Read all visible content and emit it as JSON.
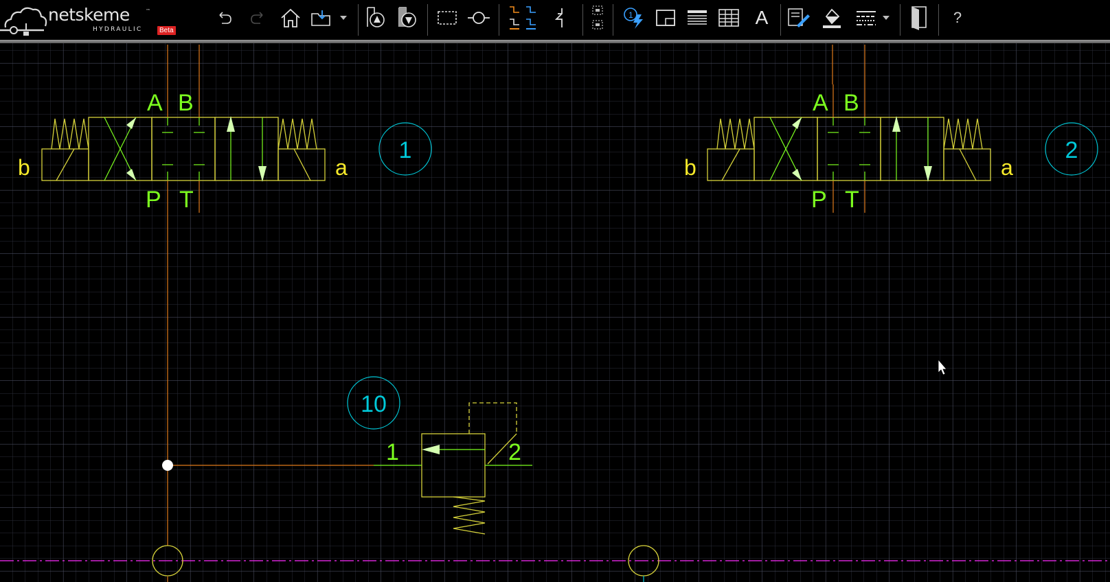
{
  "app": {
    "name": "netskeme",
    "trademark": "™",
    "subtitle": "HYDRAULIC",
    "badge": "Beta"
  },
  "toolbar": {
    "items": [
      {
        "id": "undo",
        "icon": "undo-icon"
      },
      {
        "id": "redo",
        "icon": "redo-icon"
      },
      {
        "id": "home",
        "icon": "home-icon"
      },
      {
        "id": "open",
        "icon": "open-folder-icon"
      },
      {
        "id": "open-menu",
        "icon": "dropdown-arrow-icon"
      },
      {
        "id": "add-pump",
        "icon": "add-pump-icon"
      },
      {
        "id": "add-motor",
        "icon": "add-motor-icon"
      },
      {
        "id": "select-area",
        "icon": "select-rectangle-icon"
      },
      {
        "id": "connection-point",
        "icon": "connection-point-icon"
      },
      {
        "id": "line-styles",
        "icon": "line-styles-icon"
      },
      {
        "id": "jump-line",
        "icon": "jump-line-icon"
      },
      {
        "id": "group",
        "icon": "group-icon"
      },
      {
        "id": "numbering",
        "icon": "numbering-icon"
      },
      {
        "id": "frame",
        "icon": "frame-icon"
      },
      {
        "id": "parts-list",
        "icon": "parts-list-icon"
      },
      {
        "id": "table",
        "icon": "table-icon"
      },
      {
        "id": "text",
        "icon": "text-icon",
        "label": "A"
      },
      {
        "id": "edit-properties",
        "icon": "edit-properties-icon"
      },
      {
        "id": "fill-color",
        "icon": "fill-color-icon"
      },
      {
        "id": "line-type",
        "icon": "line-type-icon"
      },
      {
        "id": "line-type-menu",
        "icon": "dropdown-arrow-icon"
      },
      {
        "id": "exit",
        "icon": "exit-door-icon"
      },
      {
        "id": "help",
        "icon": "help-icon",
        "label": "?"
      }
    ]
  },
  "schematic": {
    "valves": [
      {
        "id": 1,
        "tag": "1",
        "ports": {
          "a": "A",
          "b": "B",
          "p": "P",
          "t": "T"
        },
        "solenoid_left": "b",
        "solenoid_right": "a"
      },
      {
        "id": 2,
        "tag": "2",
        "ports": {
          "a": "A",
          "b": "B",
          "p": "P",
          "t": "T"
        },
        "solenoid_left": "b",
        "solenoid_right": "a"
      }
    ],
    "relief_valve": {
      "tag": "10",
      "port_in": "1",
      "port_out": "2"
    }
  },
  "colors": {
    "background": "#000000",
    "grid_minor": "#2a2c38",
    "grid_major": "#474a5c",
    "symbol": "#d6d23a",
    "port_label": "#7dff1f",
    "tag": "#00c8d8",
    "pressure_line": "#e07a1a",
    "tank_line": "#ff2bff",
    "junction": "#ffffff",
    "toolbar_blue": "#3aa0ff",
    "toolbar_orange": "#f08a1a"
  }
}
